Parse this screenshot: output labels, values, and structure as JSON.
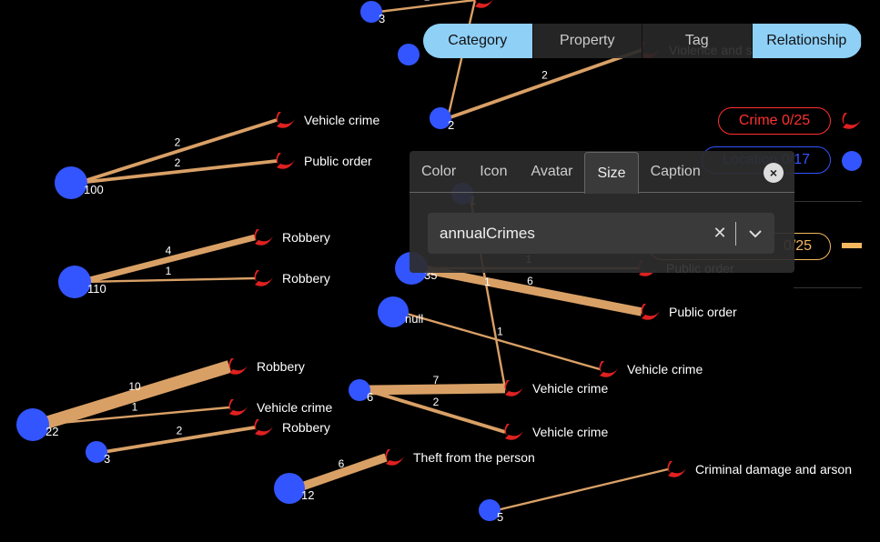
{
  "graph": {
    "locations": [
      {
        "label": "3"
      },
      {
        "label": ""
      },
      {
        "label": "2"
      },
      {
        "label": "100"
      },
      {
        "label": "110"
      },
      {
        "label": "35"
      },
      {
        "label": "null"
      },
      {
        "label": "22"
      },
      {
        "label": "3"
      },
      {
        "label": "6"
      },
      {
        "label": "12"
      },
      {
        "label": "5"
      },
      {
        "label": "1"
      }
    ],
    "crimes": [
      {
        "label": "Vehicle crime"
      },
      {
        "label": "Public order"
      },
      {
        "label": "Robbery"
      },
      {
        "label": "Robbery"
      },
      {
        "label": "Public order"
      },
      {
        "label": "Public order"
      },
      {
        "label": "Vehicle crime"
      },
      {
        "label": "Robbery"
      },
      {
        "label": "Vehicle crime"
      },
      {
        "label": "Robbery"
      },
      {
        "label": "Vehicle crime"
      },
      {
        "label": "Vehicle crime"
      },
      {
        "label": "Theft from the person"
      },
      {
        "label": "Criminal damage and arson"
      },
      {
        "label": "Violence and sexual offences"
      },
      {
        "label": ""
      }
    ],
    "edges": [
      {
        "from": 3,
        "to": 0,
        "label": "2"
      },
      {
        "from": 3,
        "to": 1,
        "label": "2"
      },
      {
        "from": 4,
        "to": 2,
        "label": "4"
      },
      {
        "from": 4,
        "to": 3,
        "label": "1"
      },
      {
        "from": 5,
        "to": 4,
        "label": "6"
      },
      {
        "from": 5,
        "to": 5,
        "label": "1"
      },
      {
        "from": 6,
        "to": 6,
        "label": "1"
      },
      {
        "from": 7,
        "to": 7,
        "label": "10"
      },
      {
        "from": 7,
        "to": 8,
        "label": "1"
      },
      {
        "from": 8,
        "to": 9,
        "label": "2"
      },
      {
        "from": 9,
        "to": 10,
        "label": "7"
      },
      {
        "from": 9,
        "to": 11,
        "label": "2"
      },
      {
        "from": 10,
        "to": 12,
        "label": "6"
      },
      {
        "from": 11,
        "to": 13,
        "label": ""
      },
      {
        "from": 2,
        "to": 14,
        "label": "2"
      },
      {
        "from": 2,
        "to": 15,
        "label": ""
      },
      {
        "from": 0,
        "to": 15,
        "label": "1"
      },
      {
        "from": 12,
        "to": 10,
        "label": "1"
      }
    ],
    "colors": {
      "location": "#3355ff",
      "crime": "#e02020",
      "edge": "#d9a066"
    }
  },
  "toolbar": {
    "items": [
      {
        "label": "Category",
        "active": true
      },
      {
        "label": "Property",
        "active": false
      },
      {
        "label": "Tag",
        "active": false
      },
      {
        "label": "Relationship",
        "active": true
      }
    ]
  },
  "legend": {
    "crime": "Crime 0/25",
    "location": "Location 0/17",
    "relationship": "0/25"
  },
  "panel": {
    "tabs": [
      {
        "label": "Color"
      },
      {
        "label": "Icon"
      },
      {
        "label": "Avatar"
      },
      {
        "label": "Size"
      },
      {
        "label": "Caption"
      }
    ],
    "active_tab": "Size",
    "close_icon": "×",
    "select_value": "annualCrimes",
    "clear_icon": "✕",
    "dropdown_icon": "⌄"
  }
}
